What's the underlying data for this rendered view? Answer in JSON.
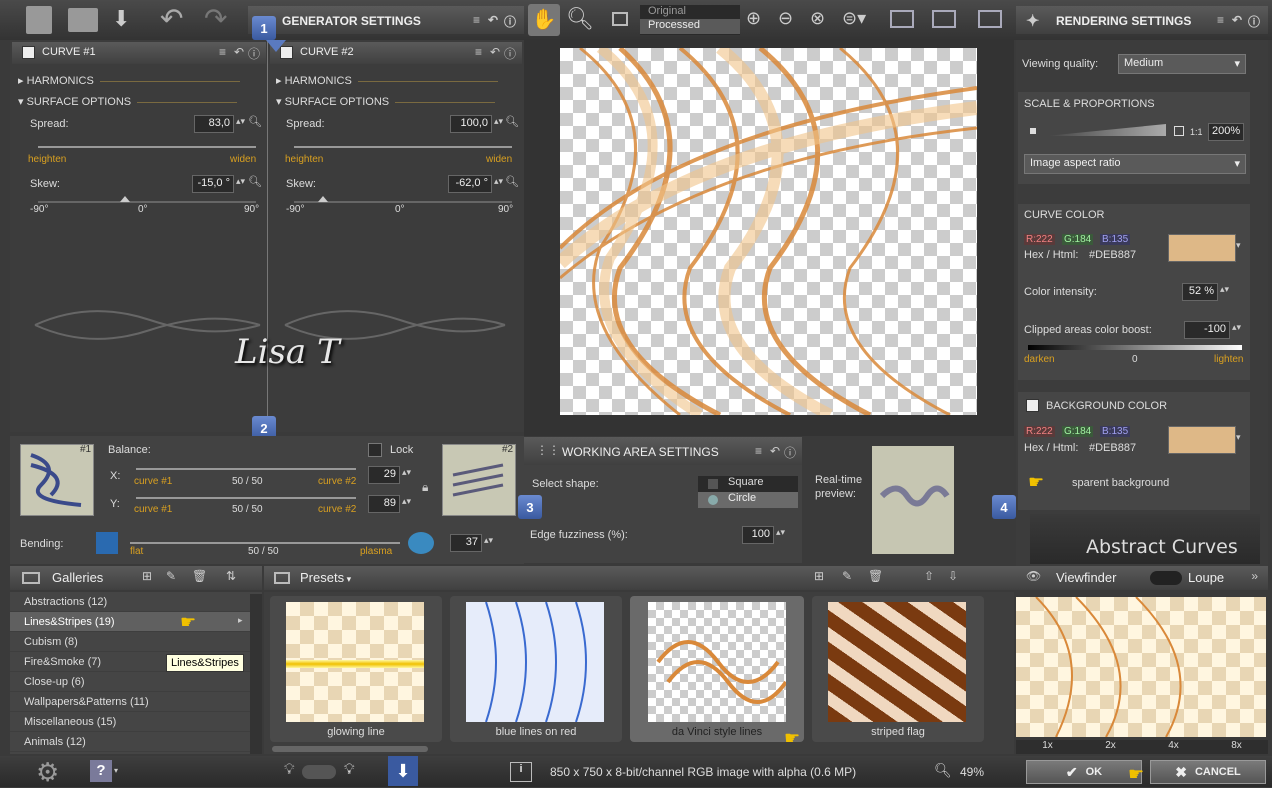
{
  "toolbar": {
    "preview_original": "Original",
    "preview_processed": "Processed"
  },
  "generator": {
    "title": "GENERATOR SETTINGS",
    "curve1": {
      "title": "CURVE #1",
      "harmonics": "HARMONICS",
      "surface": "SURFACE OPTIONS",
      "spread_label": "Spread:",
      "spread_value": "83,0",
      "heighten": "heighten",
      "widen": "widen",
      "skew_label": "Skew:",
      "skew_value": "-15,0 °",
      "tick_min": "-90°",
      "tick_mid": "0°",
      "tick_max": "90°"
    },
    "curve2": {
      "title": "CURVE #2",
      "harmonics": "HARMONICS",
      "surface": "SURFACE OPTIONS",
      "spread_label": "Spread:",
      "spread_value": "100,0",
      "heighten": "heighten",
      "widen": "widen",
      "skew_label": "Skew:",
      "skew_value": "-62,0 °",
      "tick_min": "-90°",
      "tick_mid": "0°",
      "tick_max": "90°"
    },
    "watermark": "Lisa T"
  },
  "balance": {
    "tag1": "#1",
    "tag2": "#2",
    "label": "Balance:",
    "lock": "Lock",
    "x_label": "X:",
    "y_label": "Y:",
    "curve1": "curve #1",
    "curve2": "curve #2",
    "x_ratio": "50 / 50",
    "y_ratio": "50 / 50",
    "x_value": "29",
    "y_value": "89",
    "bending_label": "Bending:",
    "flat": "flat",
    "plasma": "plasma",
    "bending_ratio": "50 / 50",
    "bending_value": "37"
  },
  "working_area": {
    "title": "WORKING AREA SETTINGS",
    "select_shape": "Select shape:",
    "square": "Square",
    "circle": "Circle",
    "edge_label": "Edge fuzziness (%):",
    "edge_value": "100",
    "realtime": "Real-time",
    "preview": "preview:"
  },
  "rendering": {
    "title": "RENDERING SETTINGS",
    "viewing_quality_label": "Viewing quality:",
    "viewing_quality_value": "Medium",
    "scale_title": "SCALE & PROPORTIONS",
    "ratio_label": "1:1",
    "zoom_value": "200%",
    "aspect": "Image aspect ratio",
    "curve_color_title": "CURVE COLOR",
    "r": "R:222",
    "g": "G:184",
    "b": "B:135",
    "hex_label": "Hex / Html:",
    "hex": "#DEB887",
    "intensity_label": "Color intensity:",
    "intensity_value": "52 %",
    "clipped_label": "Clipped areas color boost:",
    "clipped_value": "-100",
    "darken": "darken",
    "zero": "0",
    "lighten": "lighten",
    "bg_title": "BACKGROUND COLOR",
    "bg_r": "R:222",
    "bg_g": "G:184",
    "bg_b": "B:135",
    "bg_hex_label": "Hex / Html:",
    "bg_hex": "#DEB887",
    "transparent": "sparent background",
    "logo": "Abstract Curves",
    "swatch_color": "#DEB887"
  },
  "badges": [
    "1",
    "2",
    "3",
    "4"
  ],
  "galleries": {
    "title": "Galleries",
    "items": [
      "Abstractions (12)",
      "Lines&Stripes (19)",
      "Cubism (8)",
      "Fire&Smoke (7)",
      "Close-up (6)",
      "Wallpapers&Patterns (11)",
      "Miscellaneous (15)",
      "Animals (12)"
    ],
    "tooltip": "Lines&Stripes"
  },
  "presets": {
    "title": "Presets",
    "items": [
      "glowing line",
      "blue lines on red",
      "da Vinci style lines",
      "striped flag"
    ]
  },
  "viewfinder": {
    "title": "Viewfinder",
    "loupe": "Loupe",
    "zooms": [
      "1x",
      "2x",
      "4x",
      "8x"
    ]
  },
  "status": {
    "info": "850 x 750 x 8-bit/channel RGB image with alpha  (0.6 MP)",
    "zoom": "49%",
    "ok": "OK",
    "cancel": "CANCEL"
  }
}
